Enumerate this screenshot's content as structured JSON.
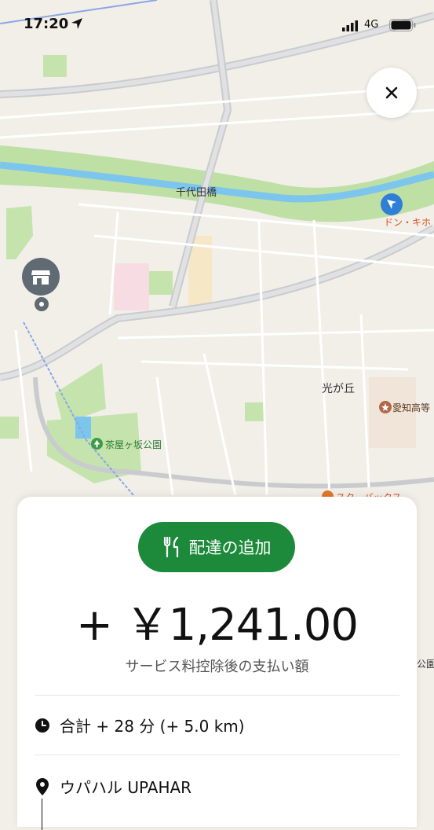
{
  "status_bar": {
    "time": "17:20",
    "network": "4G"
  },
  "map": {
    "labels": {
      "bridge": "千代田橋",
      "donki": "ドン・キホ",
      "hikarigaoka": "光が丘",
      "aichi_school": "愛知高等",
      "park": "茶屋ヶ坂公園",
      "starbucks": "スターバックス",
      "park_edge": "公園"
    }
  },
  "card": {
    "pill_label": "配達の追加",
    "amount": "+ ￥1,241.00",
    "subtitle": "サービス料控除後の支払い額",
    "total": "合計 + 28 分 (+ 5.0 km)",
    "restaurant": "ウパハル UPAHAR"
  },
  "colors": {
    "accent_green": "#1c8a3a",
    "pin_gray": "#5f6a72",
    "water_blue": "#7cc6ee"
  }
}
